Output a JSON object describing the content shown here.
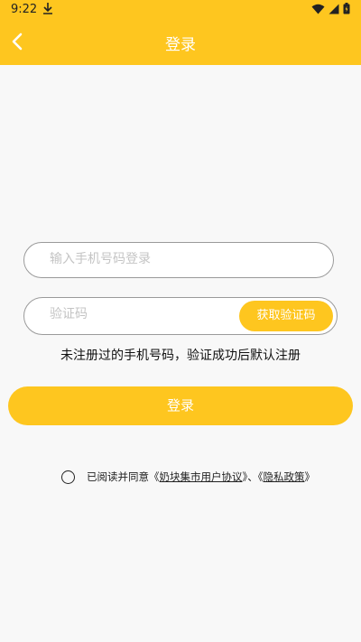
{
  "status_bar": {
    "time": "9:22"
  },
  "header": {
    "title": "登录"
  },
  "form": {
    "phone_placeholder": "输入手机号码登录",
    "code_placeholder": "验证码",
    "get_code_label": "获取验证码",
    "hint": "未注册过的手机号码，验证成功后默认注册",
    "login_label": "登录"
  },
  "agreement": {
    "prefix": "已阅读并同意《",
    "user_agreement": "奶块集市用户协议",
    "middle": "》、《",
    "privacy_policy": "隐私政策",
    "suffix": "》"
  },
  "colors": {
    "accent": "#fec61f",
    "background": "#f8f8f8"
  },
  "icons": [
    "download-icon",
    "wifi-icon",
    "signal-icon",
    "battery-icon",
    "back-arrow-icon"
  ]
}
